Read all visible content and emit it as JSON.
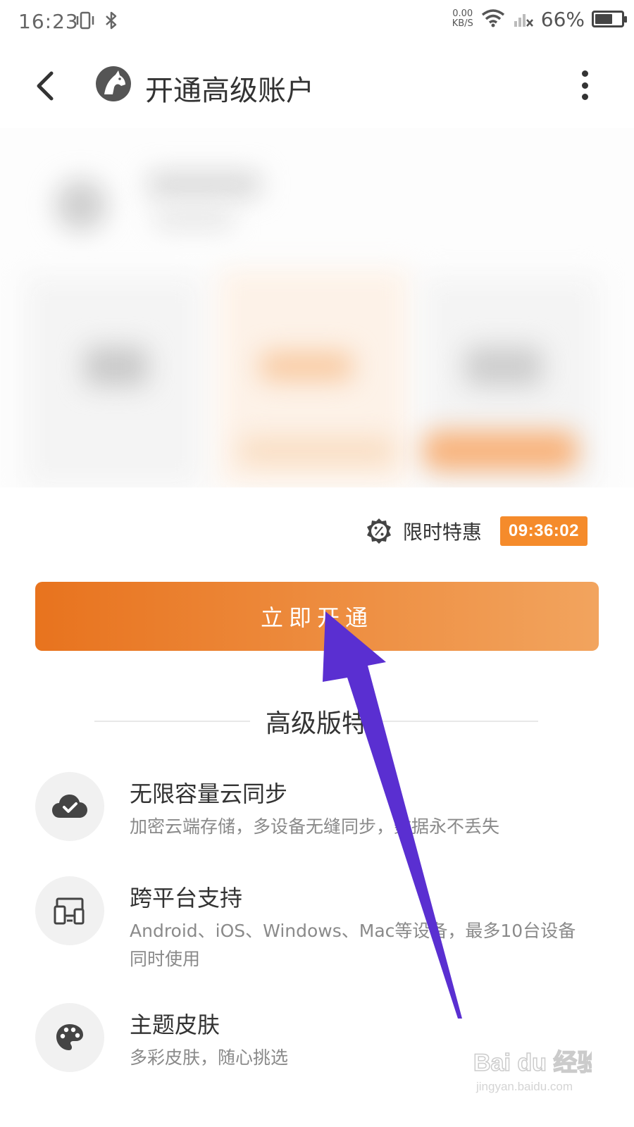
{
  "status_bar": {
    "time": "16:23",
    "net_speed_value": "0.00",
    "net_speed_unit": "KB/S",
    "battery": "66%",
    "battery_level": 0.66
  },
  "header": {
    "title": "开通高级账户"
  },
  "promo": {
    "label": "限时特惠",
    "countdown": "09:36:02"
  },
  "cta": {
    "label": "立即开通"
  },
  "features_section": {
    "title": "高级版特"
  },
  "features": [
    {
      "title": "无限容量云同步",
      "desc": "加密云端存储，多设备无缝同步，数据永不丢失",
      "icon": "cloud-check-icon"
    },
    {
      "title": "跨平台支持",
      "desc": "Android、iOS、Windows、Mac等设备，最多10台设备同时使用",
      "icon": "devices-icon"
    },
    {
      "title": "主题皮肤",
      "desc": "多彩皮肤，随心挑选",
      "icon": "palette-icon"
    }
  ],
  "colors": {
    "accent": "#f58b2b",
    "cta_start": "#e8731e",
    "cta_end": "#f2a45e",
    "annotation": "#5a2fd1"
  },
  "watermark": {
    "brand": "Bai du 经验",
    "url": "jingyan.baidu.com"
  }
}
